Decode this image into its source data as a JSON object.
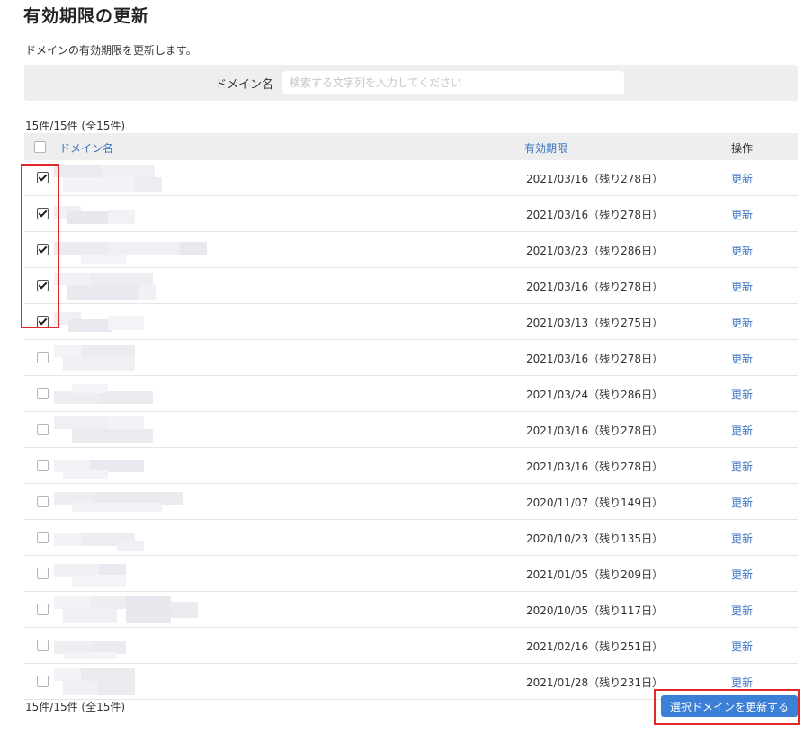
{
  "page": {
    "title": "有効期限の更新",
    "description": "ドメインの有効期限を更新します。"
  },
  "search": {
    "label": "ドメイン名",
    "placeholder": "検索する文字列を入力してください",
    "value": ""
  },
  "summary": {
    "count_top": "15件/15件 (全15件)",
    "count_bottom": "15件/15件 (全15件)"
  },
  "table": {
    "headers": {
      "domain": "ドメイン名",
      "expiry": "有効期限",
      "operation": "操作"
    },
    "rows": [
      {
        "checked": true,
        "expiry": "2021/03/16（残り278日）",
        "action": "更新"
      },
      {
        "checked": true,
        "expiry": "2021/03/16（残り278日）",
        "action": "更新"
      },
      {
        "checked": true,
        "expiry": "2021/03/23（残り286日）",
        "action": "更新"
      },
      {
        "checked": true,
        "expiry": "2021/03/16（残り278日）",
        "action": "更新"
      },
      {
        "checked": true,
        "expiry": "2021/03/13（残り275日）",
        "action": "更新"
      },
      {
        "checked": false,
        "expiry": "2021/03/16（残り278日）",
        "action": "更新"
      },
      {
        "checked": false,
        "expiry": "2021/03/24（残り286日）",
        "action": "更新"
      },
      {
        "checked": false,
        "expiry": "2021/03/16（残り278日）",
        "action": "更新"
      },
      {
        "checked": false,
        "expiry": "2021/03/16（残り278日）",
        "action": "更新"
      },
      {
        "checked": false,
        "expiry": "2020/11/07（残り149日）",
        "action": "更新"
      },
      {
        "checked": false,
        "expiry": "2020/10/23（残り135日）",
        "action": "更新"
      },
      {
        "checked": false,
        "expiry": "2021/01/05（残り209日）",
        "action": "更新"
      },
      {
        "checked": false,
        "expiry": "2020/10/05（残り117日）",
        "action": "更新"
      },
      {
        "checked": false,
        "expiry": "2021/02/16（残り251日）",
        "action": "更新"
      },
      {
        "checked": false,
        "expiry": "2021/01/28（残り231日）",
        "action": "更新"
      }
    ]
  },
  "actions": {
    "renew_selected": "選択ドメインを更新する"
  },
  "colors": {
    "link": "#3b74c0",
    "primary_button": "#3b7fd6",
    "highlight_border": "#e0282a",
    "header_background": "#eeeeee"
  }
}
